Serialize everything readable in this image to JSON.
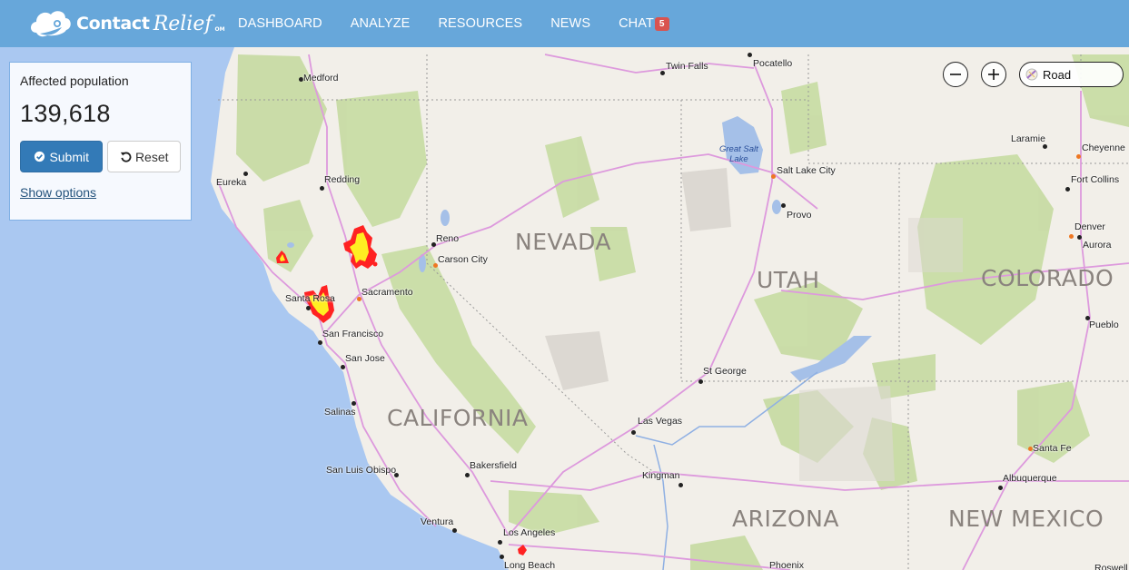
{
  "brand": {
    "name_bold": "Contact",
    "name_script": "Relief",
    "trademark": "OM"
  },
  "nav": {
    "items": [
      {
        "label": "DASHBOARD"
      },
      {
        "label": "ANALYZE"
      },
      {
        "label": "RESOURCES"
      },
      {
        "label": "NEWS"
      },
      {
        "label": "CHAT",
        "badge": "5"
      }
    ]
  },
  "panel": {
    "title": "Affected population",
    "value": "139,618",
    "submit_label": "Submit",
    "reset_label": "Reset",
    "options_link": "Show options"
  },
  "map_controls": {
    "zoom_out_icon": "minus-circle-icon",
    "zoom_in_icon": "plus-circle-icon",
    "style_label": "Road",
    "style_icon": "road-style-icon"
  },
  "map": {
    "colors": {
      "water": "#aac8f1",
      "land": "#f2efe9",
      "forest": "#c8dca5",
      "highway": "#dd99dd",
      "fire_outer": "#ff0000",
      "fire_inner": "#ffff00"
    },
    "states": [
      "NEVADA",
      "UTAH",
      "COLORADO",
      "CALIFORNIA",
      "ARIZONA",
      "NEW MEXICO"
    ],
    "lake_label": [
      "Great Salt",
      "Lake"
    ],
    "cities": [
      {
        "name": "Medford",
        "capital": false
      },
      {
        "name": "Twin Falls",
        "capital": false
      },
      {
        "name": "Pocatello",
        "capital": false
      },
      {
        "name": "Eureka",
        "capital": false
      },
      {
        "name": "Redding",
        "capital": false
      },
      {
        "name": "Reno",
        "capital": false
      },
      {
        "name": "Carson City",
        "capital": true
      },
      {
        "name": "Santa Rosa",
        "capital": false
      },
      {
        "name": "Sacramento",
        "capital": true
      },
      {
        "name": "San Francisco",
        "capital": false
      },
      {
        "name": "San Jose",
        "capital": false
      },
      {
        "name": "Salinas",
        "capital": false
      },
      {
        "name": "San Luis Obispo",
        "capital": false
      },
      {
        "name": "Bakersfield",
        "capital": false
      },
      {
        "name": "Ventura",
        "capital": false
      },
      {
        "name": "Los Angeles",
        "capital": false
      },
      {
        "name": "Long Beach",
        "capital": false
      },
      {
        "name": "Las Vegas",
        "capital": false
      },
      {
        "name": "Kingman",
        "capital": false
      },
      {
        "name": "St George",
        "capital": false
      },
      {
        "name": "Phoenix",
        "capital": false
      },
      {
        "name": "Salt Lake City",
        "capital": true
      },
      {
        "name": "Provo",
        "capital": false
      },
      {
        "name": "Laramie",
        "capital": false
      },
      {
        "name": "Cheyenne",
        "capital": true
      },
      {
        "name": "Fort Collins",
        "capital": false
      },
      {
        "name": "Denver",
        "capital": true
      },
      {
        "name": "Aurora",
        "capital": false
      },
      {
        "name": "Pueblo",
        "capital": false
      },
      {
        "name": "Santa Fe",
        "capital": true
      },
      {
        "name": "Albuquerque",
        "capital": false
      },
      {
        "name": "Roswell",
        "capital": false
      }
    ],
    "fire_areas": [
      "north-valley-fire",
      "mendocino-fire",
      "sonoma-napa-fire",
      "los-angeles-fire"
    ]
  }
}
